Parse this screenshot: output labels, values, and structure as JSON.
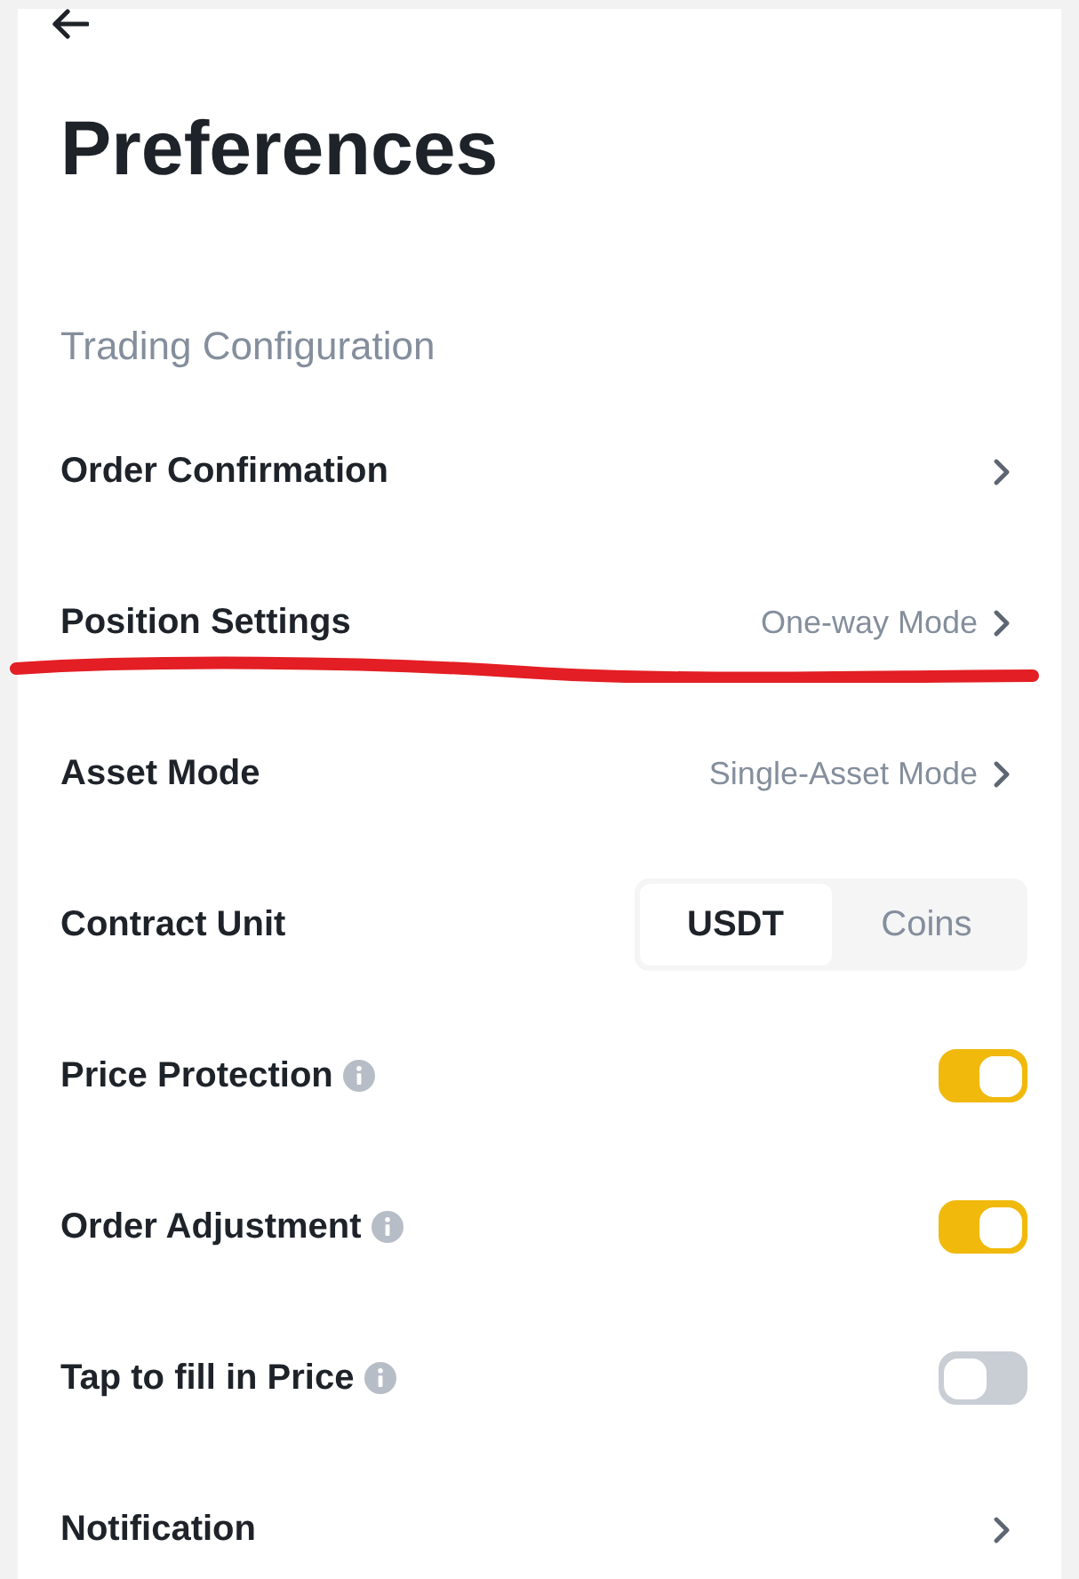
{
  "header": {
    "title": "Preferences"
  },
  "section": {
    "label": "Trading Configuration"
  },
  "rows": [
    {
      "kind": "link",
      "label": "Order Confirmation",
      "info": false,
      "marked": false
    },
    {
      "kind": "link",
      "label": "Position Settings",
      "value": "One-way Mode",
      "info": false,
      "marked": true
    },
    {
      "kind": "link",
      "label": "Asset Mode",
      "value": "Single-Asset Mode",
      "info": false,
      "marked": false
    },
    {
      "kind": "segmented",
      "label": "Contract Unit",
      "options": [
        {
          "label": "USDT",
          "selected": true
        },
        {
          "label": "Coins",
          "selected": false
        }
      ],
      "info": false,
      "marked": false
    },
    {
      "kind": "toggle",
      "label": "Price Protection",
      "info": true,
      "on": true,
      "marked": false
    },
    {
      "kind": "toggle",
      "label": "Order Adjustment",
      "info": true,
      "on": true,
      "marked": false
    },
    {
      "kind": "toggle",
      "label": "Tap to fill in Price",
      "info": true,
      "on": false,
      "marked": false
    },
    {
      "kind": "link",
      "label": "Notification",
      "info": false,
      "marked": false
    }
  ]
}
